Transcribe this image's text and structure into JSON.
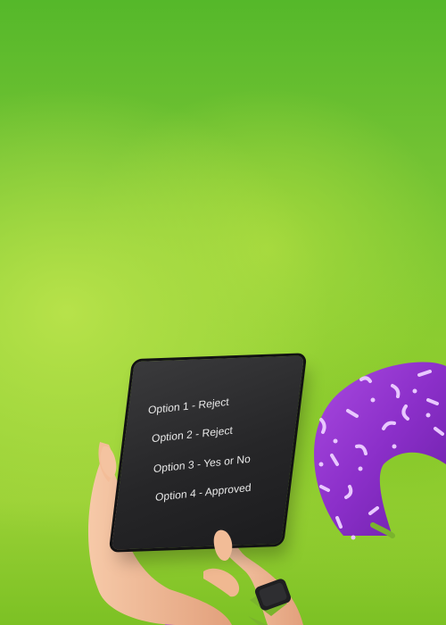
{
  "menu": {
    "options": [
      {
        "label": "Option 1 - Reject"
      },
      {
        "label": "Option 2 - Reject"
      },
      {
        "label": "Option 3 - Yes or No"
      },
      {
        "label": "Option 4 - Approved"
      }
    ]
  },
  "colors": {
    "background_top": "#55b82a",
    "background_mid": "#9ad136",
    "tablet": "#262628",
    "tube": "#8b2fc9",
    "skin": "#efb693",
    "watch_band": "#7ab42c"
  }
}
